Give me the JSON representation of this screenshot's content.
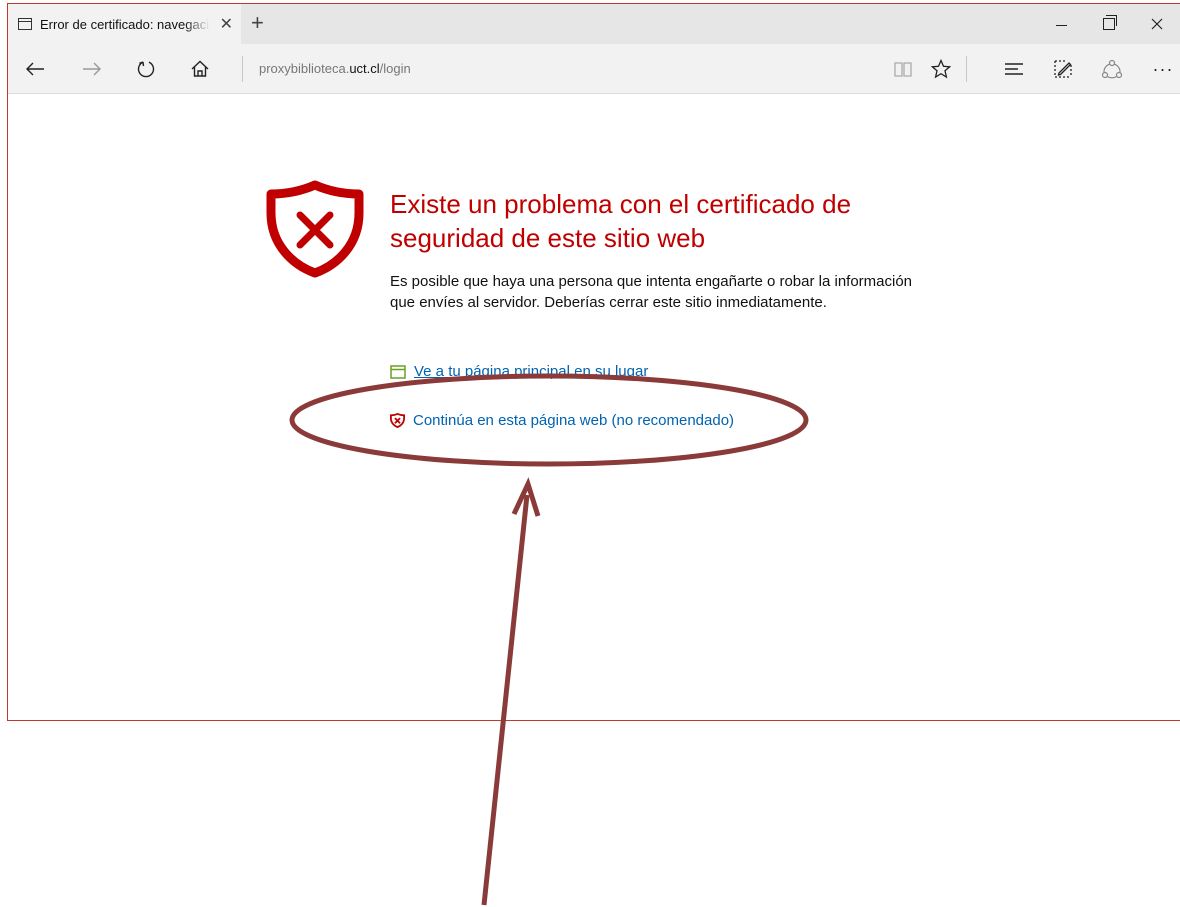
{
  "browser": {
    "tab_title": "Error de certificado: navegación bloqueada",
    "tab_close": "✕",
    "new_tab": "+",
    "address": {
      "prefix": "proxybiblioteca.",
      "domain": "uct.cl",
      "path": "/login"
    },
    "more_label": "···"
  },
  "error_page": {
    "heading": "Existe un problema con el certificado de seguridad de este sitio web",
    "description": "Es posible que haya una persona que intenta engañarte o robar la información que envíes al servidor. Deberías cerrar este sitio inmediatamente.",
    "home_link": "Ve a tu página principal en su lugar",
    "continue_link": "Continúa en esta página web (no recomendado)"
  },
  "icons": {
    "tab": "page-icon",
    "back": "back-arrow-icon",
    "forward": "forward-arrow-icon",
    "refresh": "refresh-icon",
    "home": "home-icon",
    "reading_view": "reading-view-icon",
    "favorites": "star-icon",
    "hub": "hub-icon",
    "web_note": "web-note-icon",
    "share": "share-icon",
    "error_shield": "shield-x-icon",
    "home_link": "window-icon",
    "continue_link": "shield-x-small-icon"
  },
  "colors": {
    "error_red": "#c00000",
    "link_blue": "#0063b1",
    "home_icon_green": "#6aa121",
    "annotation": "#8b3a3a"
  }
}
